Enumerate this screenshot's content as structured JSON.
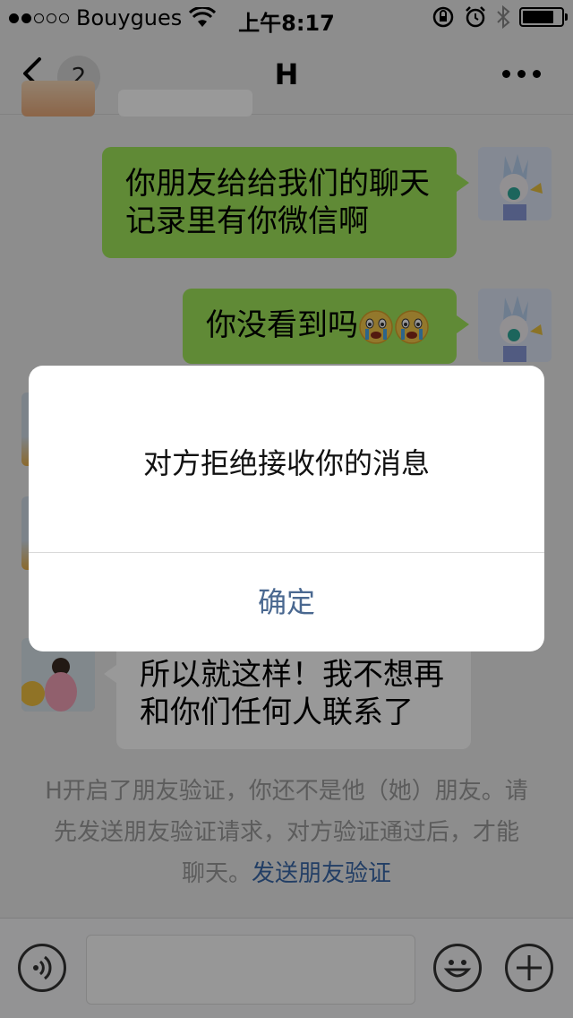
{
  "status_bar": {
    "carrier": "Bouygues",
    "time": "上午8:17",
    "signal_dots_filled": 2,
    "signal_dots_total": 5
  },
  "nav": {
    "title": "H",
    "unread_count": "2"
  },
  "messages": [
    {
      "from": "me",
      "text_line1": "你朋友给给我们的聊天",
      "text_line2": "记录里有你微信啊"
    },
    {
      "from": "me",
      "text": "你没看到吗",
      "emoji": [
        "crying-face-icon",
        "crying-face-icon"
      ]
    },
    {
      "from": "her",
      "text_line1": "所以就这样！我不想再",
      "text_line2": "和你们任何人联系了"
    }
  ],
  "system_notice": {
    "text": "H开启了朋友验证，你还不是他（她）朋友。请先发送朋友验证请求，对方验证通过后，才能聊天。",
    "link": "发送朋友验证"
  },
  "dialog": {
    "message": "对方拒绝接收你的消息",
    "confirm_label": "确定"
  },
  "colors": {
    "sent_bubble": "#a0e75a",
    "link": "#3a68a8",
    "dialog_button": "#4a6890"
  }
}
